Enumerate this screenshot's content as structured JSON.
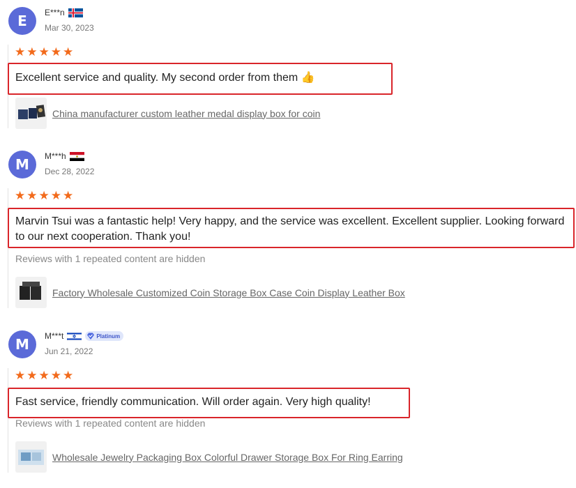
{
  "reviews": [
    {
      "avatar_letter": "E",
      "name": "E***n",
      "flag_icon": "iceland-flag-icon",
      "date": "Mar 30, 2023",
      "rating": 5,
      "stars": "★★★★★",
      "comment": "Excellent service and quality. My second order from them 👍",
      "product": "China manufacturer custom leather medal display box for coin"
    },
    {
      "avatar_letter": "M",
      "name": "M***h",
      "flag_icon": "egypt-flag-icon",
      "date": "Dec 28, 2022",
      "rating": 5,
      "stars": "★★★★★",
      "comment": "Marvin Tsui was a fantastic help! Very happy, and the service was excellent. Excellent supplier. Looking forward to our next cooperation. Thank you!",
      "hidden_note": "Reviews with 1 repeated content are hidden",
      "product": "Factory Wholesale Customized Coin Storage Box Case Coin Display Leather Box"
    },
    {
      "avatar_letter": "M",
      "name": "M***t",
      "flag_icon": "israel-flag-icon",
      "badge": "Platinum",
      "date": "Jun 21, 2022",
      "rating": 5,
      "stars": "★★★★★",
      "comment": "Fast service, friendly communication. Will order again. Very high quality!",
      "hidden_note": "Reviews with 1 repeated content are hidden",
      "product": "Wholesale Jewelry Packaging Box Colorful Drawer Storage Box For Ring Earring"
    }
  ],
  "colors": {
    "avatar": "#5b6ad8",
    "star": "#f26a1b",
    "highlight_border": "#d9252a",
    "badge_bg": "#dfe6fb",
    "badge_text": "#3d55c8"
  }
}
